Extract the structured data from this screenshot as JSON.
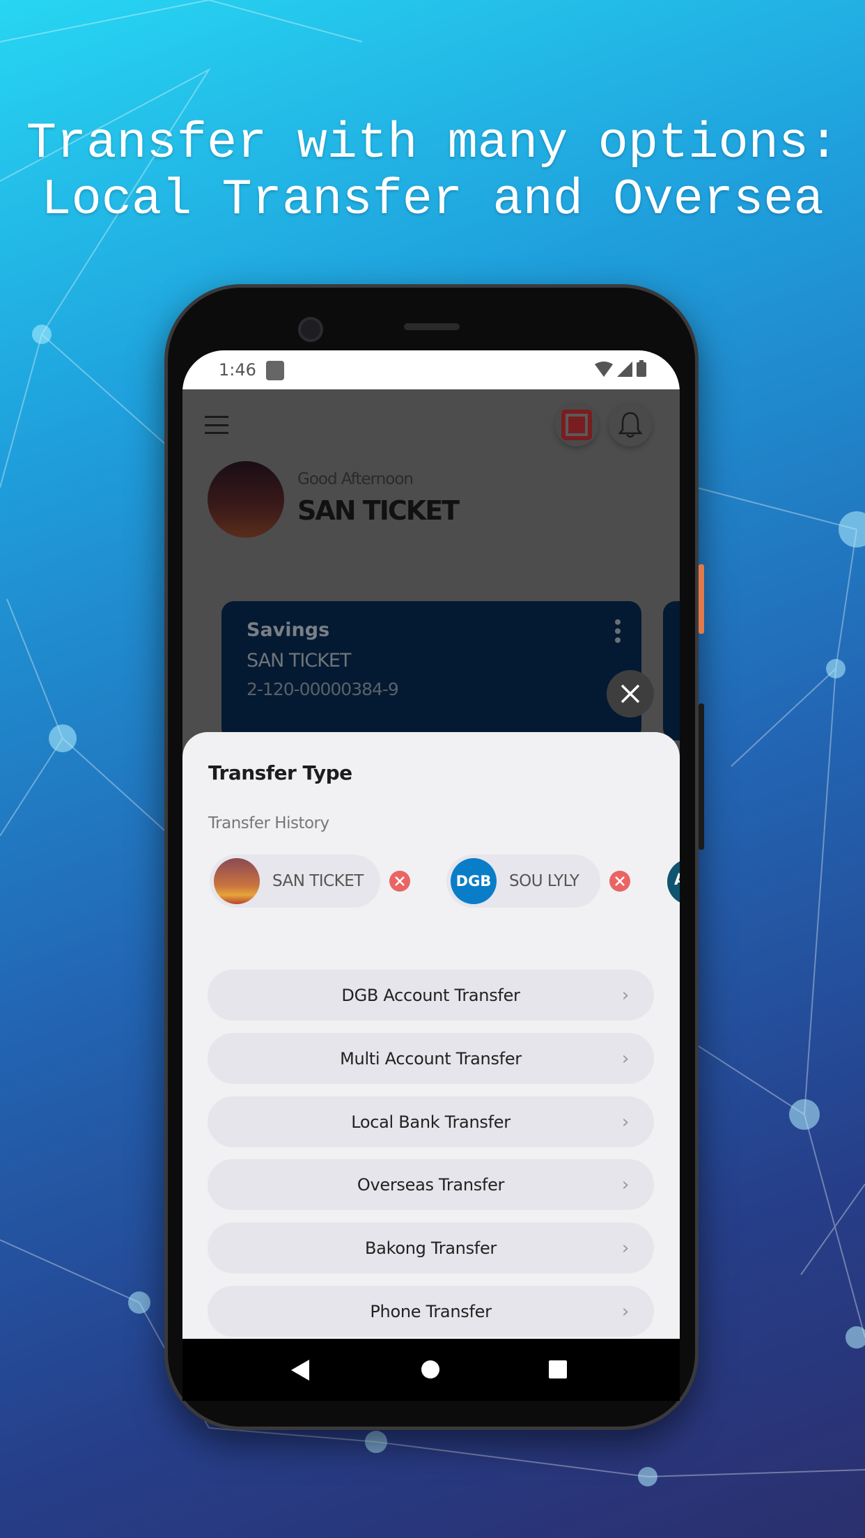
{
  "headline": {
    "line1": "Transfer with many options:",
    "line2": "Local Transfer and Oversea"
  },
  "status_bar": {
    "time": "1:46"
  },
  "header": {
    "greeting": "Good Afternoon",
    "user_name": "SAN TICKET",
    "scan_color": "#d9343a"
  },
  "account_card": {
    "type": "Savings",
    "holder": "SAN TICKET",
    "number": "2-120-00000384-9"
  },
  "sheet": {
    "title": "Transfer Type",
    "history_title": "Transfer History",
    "history": [
      {
        "name": "SAN TICKET",
        "avatar": "sunset-photo"
      },
      {
        "name": "SOU LYLY",
        "avatar_text": "DGB",
        "avatar_color": "#0a7dc9"
      },
      {
        "avatar_text": "A",
        "avatar_color": "#0f5570"
      }
    ],
    "options": [
      {
        "label": "DGB Account Transfer"
      },
      {
        "label": "Multi Account Transfer"
      },
      {
        "label": "Local Bank Transfer"
      },
      {
        "label": "Overseas Transfer"
      },
      {
        "label": "Bakong Transfer"
      },
      {
        "label": "Phone Transfer"
      }
    ]
  }
}
